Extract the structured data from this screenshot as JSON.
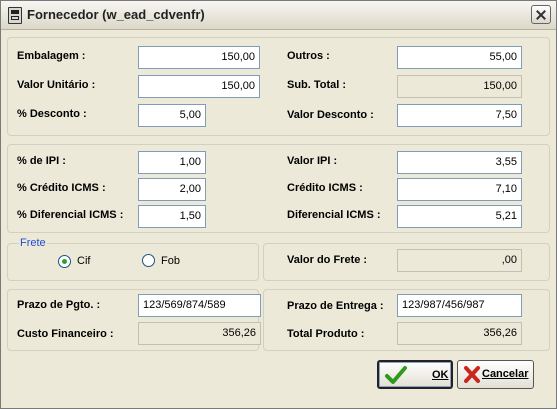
{
  "window": {
    "title": "Fornecedor (w_ead_cdvenfr)"
  },
  "section1": {
    "embalagem_label": "Embalagem :",
    "embalagem_value": "150,00",
    "valor_unitario_label": "Valor Unitário :",
    "valor_unitario_value": "150,00",
    "desconto_pct_label": "% Desconto :",
    "desconto_pct_value": "5,00",
    "outros_label": "Outros :",
    "outros_value": "55,00",
    "sub_total_label": "Sub. Total :",
    "sub_total_value": "150,00",
    "valor_desconto_label": "Valor Desconto :",
    "valor_desconto_value": "7,50"
  },
  "section2": {
    "ipi_pct_label": "% de IPI :",
    "ipi_pct_value": "1,00",
    "credito_icms_pct_label": "% Crédito ICMS :",
    "credito_icms_pct_value": "2,00",
    "diferencial_icms_pct_label": "% Diferencial ICMS :",
    "diferencial_icms_pct_value": "1,50",
    "valor_ipi_label": "Valor IPI :",
    "valor_ipi_value": "3,55",
    "credito_icms_label": "Crédito ICMS :",
    "credito_icms_value": "7,10",
    "diferencial_icms_label": "Diferencial ICMS :",
    "diferencial_icms_value": "5,21"
  },
  "frete": {
    "title": "Frete",
    "option_cif": "Cif",
    "option_fob": "Fob",
    "selected": "Cif",
    "valor_frete_label": "Valor do Frete :",
    "valor_frete_value": ",00"
  },
  "section3": {
    "prazo_pgto_label": "Prazo de Pgto. :",
    "prazo_pgto_value": "123/569/874/589",
    "custo_financeiro_label": "Custo Financeiro :",
    "custo_financeiro_value": "356,26",
    "prazo_entrega_label": "Prazo de Entrega :",
    "prazo_entrega_value": "123/987/456/987",
    "total_produto_label": "Total Produto :",
    "total_produto_value": "356,26"
  },
  "buttons": {
    "ok_label": "OK",
    "cancelar_label": "Cancelar"
  },
  "colors": {
    "frete_title": "#1f4fd0",
    "ok_check": "#2e9a1e",
    "cancel_x": "#c8281e"
  },
  "icons": {
    "ok": "check-icon",
    "cancel": "x-icon",
    "app": "app-icon",
    "close": "close-icon"
  }
}
